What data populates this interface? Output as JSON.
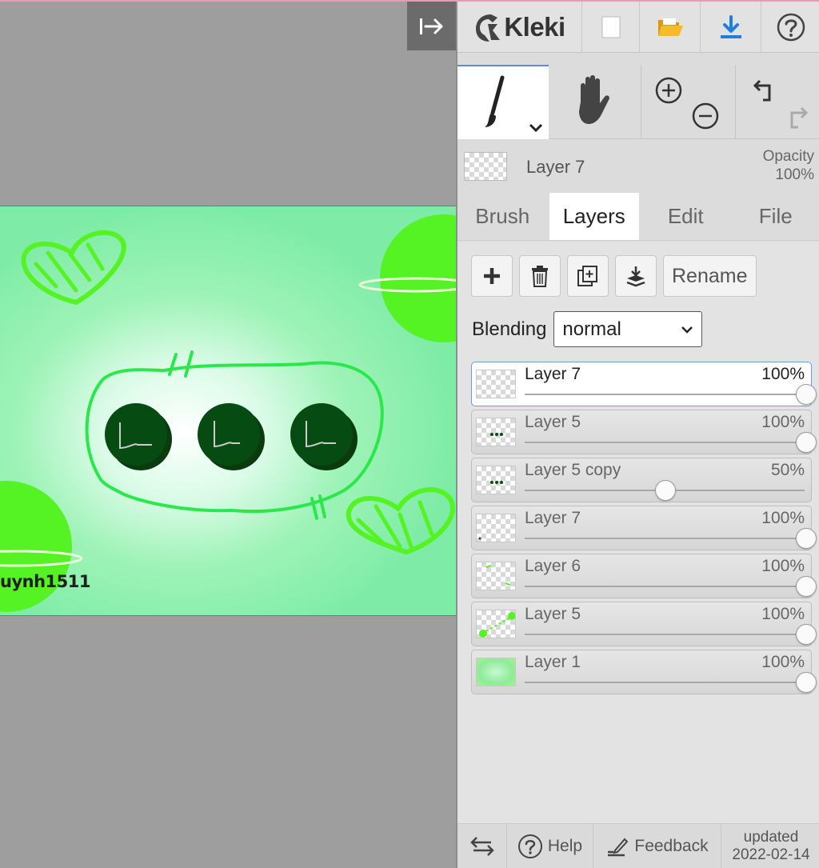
{
  "topbar": {
    "logo_text": "Kleki",
    "icons": [
      "kleki-logo-icon",
      "new-image-icon",
      "open-folder-icon",
      "download-icon",
      "help-icon"
    ],
    "accent_folder": "#f2b01e",
    "accent_download": "#1f7ee0"
  },
  "canvas": {
    "toggle_icon": "collapse-panel-icon",
    "watermark": "uynh1511"
  },
  "tools": [
    "brush-tool-icon",
    "hand-tool-icon",
    "zoom-in-icon",
    "zoom-out-icon",
    "undo-icon",
    "redo-icon"
  ],
  "current_layer": {
    "name": "Layer 7",
    "opacity_label": "Opacity",
    "opacity_value": "100%"
  },
  "tabs": [
    {
      "label": "Brush",
      "active": false
    },
    {
      "label": "Layers",
      "active": true
    },
    {
      "label": "Edit",
      "active": false
    },
    {
      "label": "File",
      "active": false
    }
  ],
  "layer_buttons": {
    "add_icon": "add-layer-icon",
    "delete_icon": "delete-layer-icon",
    "duplicate_icon": "duplicate-layer-icon",
    "merge_icon": "merge-down-icon",
    "rename_label": "Rename"
  },
  "blending": {
    "label": "Blending",
    "value": "normal"
  },
  "layers": [
    {
      "name": "Layer 7",
      "opacity": "100%",
      "opacity_value": 1.0,
      "selected": true
    },
    {
      "name": "Layer 5",
      "opacity": "100%",
      "opacity_value": 1.0,
      "selected": false
    },
    {
      "name": "Layer 5 copy",
      "opacity": "50%",
      "opacity_value": 0.5,
      "selected": false
    },
    {
      "name": "Layer 7",
      "opacity": "100%",
      "opacity_value": 1.0,
      "selected": false
    },
    {
      "name": "Layer 6",
      "opacity": "100%",
      "opacity_value": 1.0,
      "selected": false
    },
    {
      "name": "Layer 5",
      "opacity": "100%",
      "opacity_value": 1.0,
      "selected": false
    },
    {
      "name": "Layer 1",
      "opacity": "100%",
      "opacity_value": 1.0,
      "selected": false
    }
  ],
  "footer": {
    "swap_icon": "swap-side-icon",
    "help_label": "Help",
    "feedback_label": "Feedback",
    "updated_line1": "updated",
    "updated_line2": "2022-02-14"
  }
}
